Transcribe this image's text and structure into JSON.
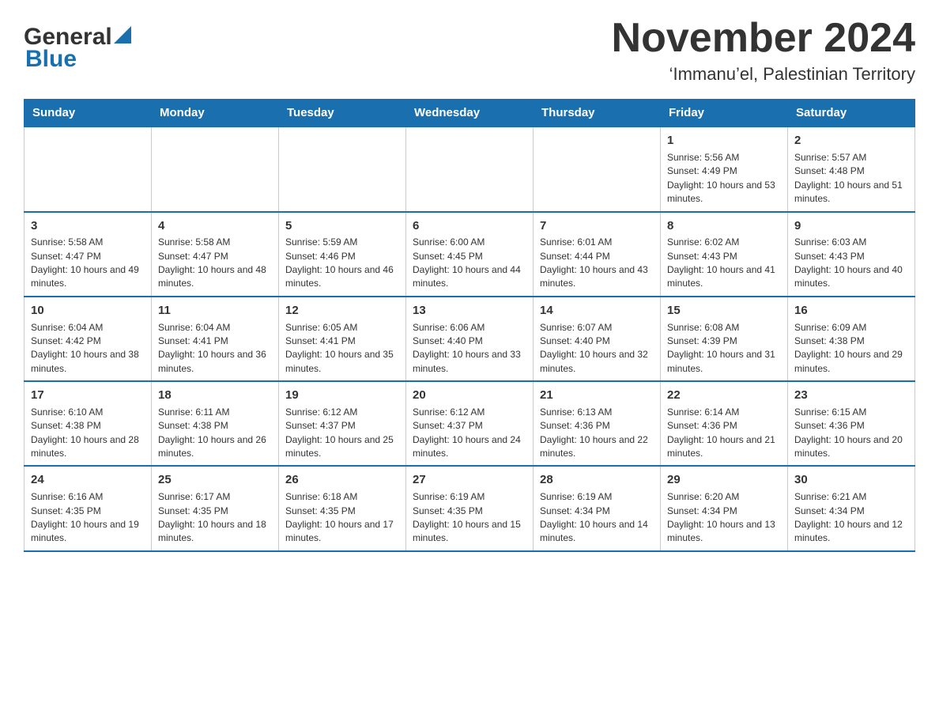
{
  "header": {
    "logo_general": "General",
    "logo_blue": "Blue",
    "month_title": "November 2024",
    "subtitle": "‘Immanu’el, Palestinian Territory"
  },
  "calendar": {
    "days_of_week": [
      "Sunday",
      "Monday",
      "Tuesday",
      "Wednesday",
      "Thursday",
      "Friday",
      "Saturday"
    ],
    "weeks": [
      [
        {
          "day": "",
          "info": ""
        },
        {
          "day": "",
          "info": ""
        },
        {
          "day": "",
          "info": ""
        },
        {
          "day": "",
          "info": ""
        },
        {
          "day": "",
          "info": ""
        },
        {
          "day": "1",
          "info": "Sunrise: 5:56 AM\nSunset: 4:49 PM\nDaylight: 10 hours and 53 minutes."
        },
        {
          "day": "2",
          "info": "Sunrise: 5:57 AM\nSunset: 4:48 PM\nDaylight: 10 hours and 51 minutes."
        }
      ],
      [
        {
          "day": "3",
          "info": "Sunrise: 5:58 AM\nSunset: 4:47 PM\nDaylight: 10 hours and 49 minutes."
        },
        {
          "day": "4",
          "info": "Sunrise: 5:58 AM\nSunset: 4:47 PM\nDaylight: 10 hours and 48 minutes."
        },
        {
          "day": "5",
          "info": "Sunrise: 5:59 AM\nSunset: 4:46 PM\nDaylight: 10 hours and 46 minutes."
        },
        {
          "day": "6",
          "info": "Sunrise: 6:00 AM\nSunset: 4:45 PM\nDaylight: 10 hours and 44 minutes."
        },
        {
          "day": "7",
          "info": "Sunrise: 6:01 AM\nSunset: 4:44 PM\nDaylight: 10 hours and 43 minutes."
        },
        {
          "day": "8",
          "info": "Sunrise: 6:02 AM\nSunset: 4:43 PM\nDaylight: 10 hours and 41 minutes."
        },
        {
          "day": "9",
          "info": "Sunrise: 6:03 AM\nSunset: 4:43 PM\nDaylight: 10 hours and 40 minutes."
        }
      ],
      [
        {
          "day": "10",
          "info": "Sunrise: 6:04 AM\nSunset: 4:42 PM\nDaylight: 10 hours and 38 minutes."
        },
        {
          "day": "11",
          "info": "Sunrise: 6:04 AM\nSunset: 4:41 PM\nDaylight: 10 hours and 36 minutes."
        },
        {
          "day": "12",
          "info": "Sunrise: 6:05 AM\nSunset: 4:41 PM\nDaylight: 10 hours and 35 minutes."
        },
        {
          "day": "13",
          "info": "Sunrise: 6:06 AM\nSunset: 4:40 PM\nDaylight: 10 hours and 33 minutes."
        },
        {
          "day": "14",
          "info": "Sunrise: 6:07 AM\nSunset: 4:40 PM\nDaylight: 10 hours and 32 minutes."
        },
        {
          "day": "15",
          "info": "Sunrise: 6:08 AM\nSunset: 4:39 PM\nDaylight: 10 hours and 31 minutes."
        },
        {
          "day": "16",
          "info": "Sunrise: 6:09 AM\nSunset: 4:38 PM\nDaylight: 10 hours and 29 minutes."
        }
      ],
      [
        {
          "day": "17",
          "info": "Sunrise: 6:10 AM\nSunset: 4:38 PM\nDaylight: 10 hours and 28 minutes."
        },
        {
          "day": "18",
          "info": "Sunrise: 6:11 AM\nSunset: 4:38 PM\nDaylight: 10 hours and 26 minutes."
        },
        {
          "day": "19",
          "info": "Sunrise: 6:12 AM\nSunset: 4:37 PM\nDaylight: 10 hours and 25 minutes."
        },
        {
          "day": "20",
          "info": "Sunrise: 6:12 AM\nSunset: 4:37 PM\nDaylight: 10 hours and 24 minutes."
        },
        {
          "day": "21",
          "info": "Sunrise: 6:13 AM\nSunset: 4:36 PM\nDaylight: 10 hours and 22 minutes."
        },
        {
          "day": "22",
          "info": "Sunrise: 6:14 AM\nSunset: 4:36 PM\nDaylight: 10 hours and 21 minutes."
        },
        {
          "day": "23",
          "info": "Sunrise: 6:15 AM\nSunset: 4:36 PM\nDaylight: 10 hours and 20 minutes."
        }
      ],
      [
        {
          "day": "24",
          "info": "Sunrise: 6:16 AM\nSunset: 4:35 PM\nDaylight: 10 hours and 19 minutes."
        },
        {
          "day": "25",
          "info": "Sunrise: 6:17 AM\nSunset: 4:35 PM\nDaylight: 10 hours and 18 minutes."
        },
        {
          "day": "26",
          "info": "Sunrise: 6:18 AM\nSunset: 4:35 PM\nDaylight: 10 hours and 17 minutes."
        },
        {
          "day": "27",
          "info": "Sunrise: 6:19 AM\nSunset: 4:35 PM\nDaylight: 10 hours and 15 minutes."
        },
        {
          "day": "28",
          "info": "Sunrise: 6:19 AM\nSunset: 4:34 PM\nDaylight: 10 hours and 14 minutes."
        },
        {
          "day": "29",
          "info": "Sunrise: 6:20 AM\nSunset: 4:34 PM\nDaylight: 10 hours and 13 minutes."
        },
        {
          "day": "30",
          "info": "Sunrise: 6:21 AM\nSunset: 4:34 PM\nDaylight: 10 hours and 12 minutes."
        }
      ]
    ]
  }
}
